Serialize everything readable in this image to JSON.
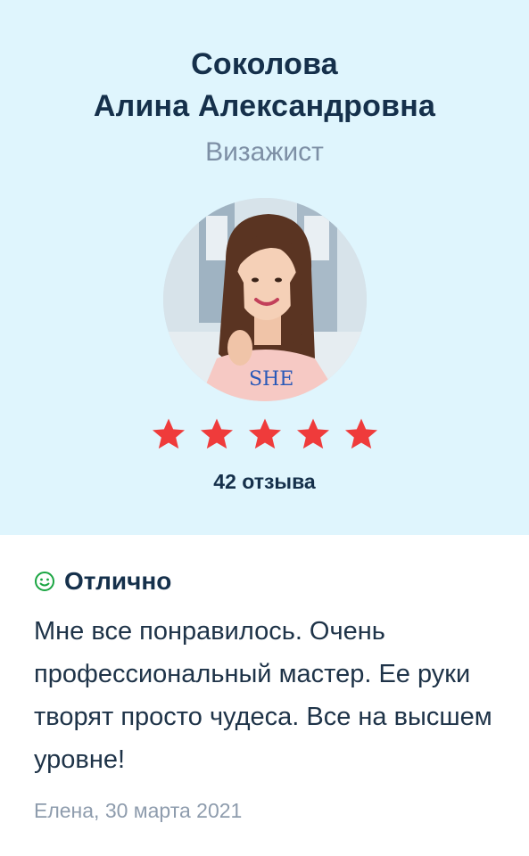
{
  "profile": {
    "last_name": "Соколова",
    "first_middle": "Алина Александровна",
    "role": "Визажист",
    "rating_stars": 5,
    "reviews_count": "42 отзыва"
  },
  "review": {
    "rating_label": "Отлично",
    "mood_icon": "smile-icon",
    "text": "Мне все понравилось. Очень профессиональный мастер. Ее руки творят просто чудеса. Все на высшем уровне!",
    "meta": "Елена, 30 марта 2021"
  },
  "colors": {
    "hero_bg": "#dff5fd",
    "star": "#ef3b3b",
    "smile": "#1aa542",
    "title": "#15304b",
    "muted": "#7d8fa5"
  }
}
